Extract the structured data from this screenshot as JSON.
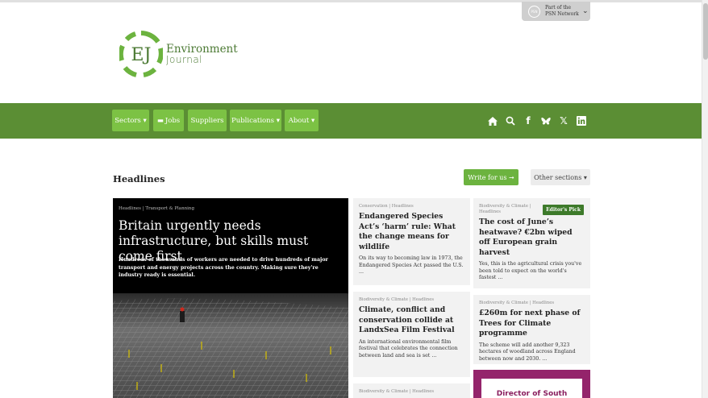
{
  "network": {
    "label": "Part of the PSN Network",
    "logo_text": "PSN"
  },
  "logo": {
    "letters": "EJ",
    "line1": "Environment",
    "line2": "Journal"
  },
  "nav": {
    "buttons": [
      {
        "label": "Sectors ▾"
      },
      {
        "label": "Jobs"
      },
      {
        "label": "Suppliers"
      },
      {
        "label": "Publications ▾"
      },
      {
        "label": "About ▾"
      }
    ],
    "icons": [
      "home-icon",
      "search-icon",
      "facebook-icon",
      "bluesky-icon",
      "x-icon",
      "linkedin-icon"
    ]
  },
  "section": {
    "title": "Headlines",
    "write_label": "Write for us  ➞",
    "other_label": "Other sections  ▾"
  },
  "hero": {
    "category": "Headlines | Transport & Planning",
    "title": "Britain urgently needs infrastructure, but skills must come first",
    "summary": "Hundreds of thousands of workers are needed to drive hundreds of major transport and energy projects across the country. Making sure they're industry ready is essential."
  },
  "cards": [
    {
      "category": "Conservation | Headlines",
      "title": "Endangered Species Act’s ‘harm’ rule: What the change means for wildlife",
      "excerpt": "On its way to becoming law in 1973, the Endangered Species Act passed the U.S. ..."
    },
    {
      "category": "Biodiversity & Climate | Headlines",
      "title": "The cost of June’s heatwave? €2bn wiped off European grain harvest",
      "excerpt": "Yes, this is the agricultural crisis you've been told to expect on the world's fastest ...",
      "badge": "Editor's Pick"
    },
    {
      "category": "Biodiversity & Climate | Headlines",
      "title": "Climate, conflict and conservation collide at LandxSea Film Festival",
      "excerpt": "An international environmental film festival that celebrates the connection between land and sea is set ..."
    },
    {
      "category": "Biodiversity & Climate | Headlines",
      "title": "£260m for next phase of Trees for Climate programme",
      "excerpt": "The scheme will add another 9,323 hectares of woodland across England between now and 2030.  ..."
    },
    {
      "category": "Biodiversity & Climate | Headlines",
      "title": "",
      "excerpt": ""
    }
  ],
  "ad": {
    "text": "Director of South"
  },
  "colors": {
    "nav_bg": "#5b8e34",
    "nav_button": "#7cc244",
    "accent": "#6cb33f",
    "ad_bg": "#94246b"
  }
}
